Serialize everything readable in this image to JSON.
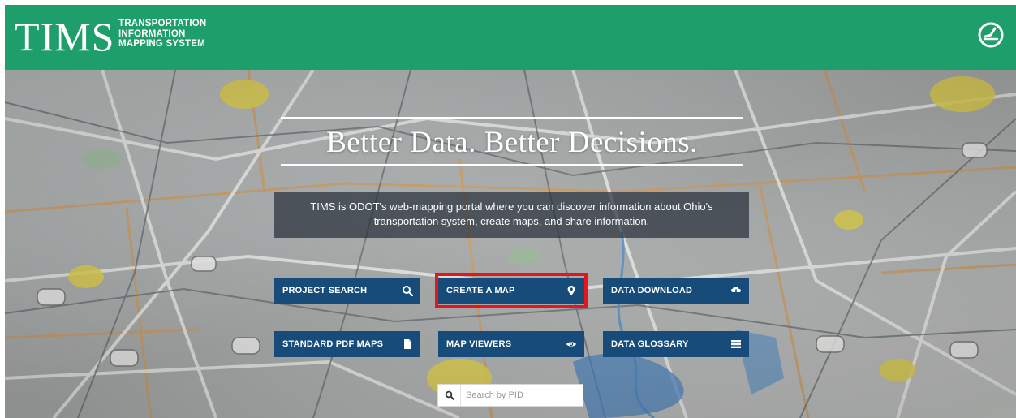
{
  "header": {
    "logo_text": "TIMS",
    "logo_subtitle_lines": [
      "TRANSPORTATION",
      "INFORMATION",
      "MAPPING SYSTEM"
    ],
    "menu_icon": "clock-compass-icon",
    "background_color": "#1d9e6a"
  },
  "hero": {
    "tagline": "Better Data. Better Decisions.",
    "intro_lines": [
      "TIMS is ODOT's web-mapping portal where you can discover information about Ohio's",
      "transportation system, create maps, and share information."
    ],
    "background": "road-map-photo"
  },
  "actions": [
    {
      "label": "PROJECT SEARCH",
      "icon": "search-icon"
    },
    {
      "label": "CREATE A MAP",
      "icon": "map-pin-icon",
      "highlighted": true
    },
    {
      "label": "DATA DOWNLOAD",
      "icon": "cloud-download-icon"
    },
    {
      "label": "STANDARD PDF MAPS",
      "icon": "document-icon"
    },
    {
      "label": "MAP VIEWERS",
      "icon": "eye-icon"
    },
    {
      "label": "DATA GLOSSARY",
      "icon": "list-icon"
    }
  ],
  "search": {
    "placeholder": "Search by PID",
    "value": ""
  },
  "colors": {
    "header_green": "#1d9e6a",
    "button_blue": "#164b7a",
    "highlight_red": "#e8141c"
  }
}
